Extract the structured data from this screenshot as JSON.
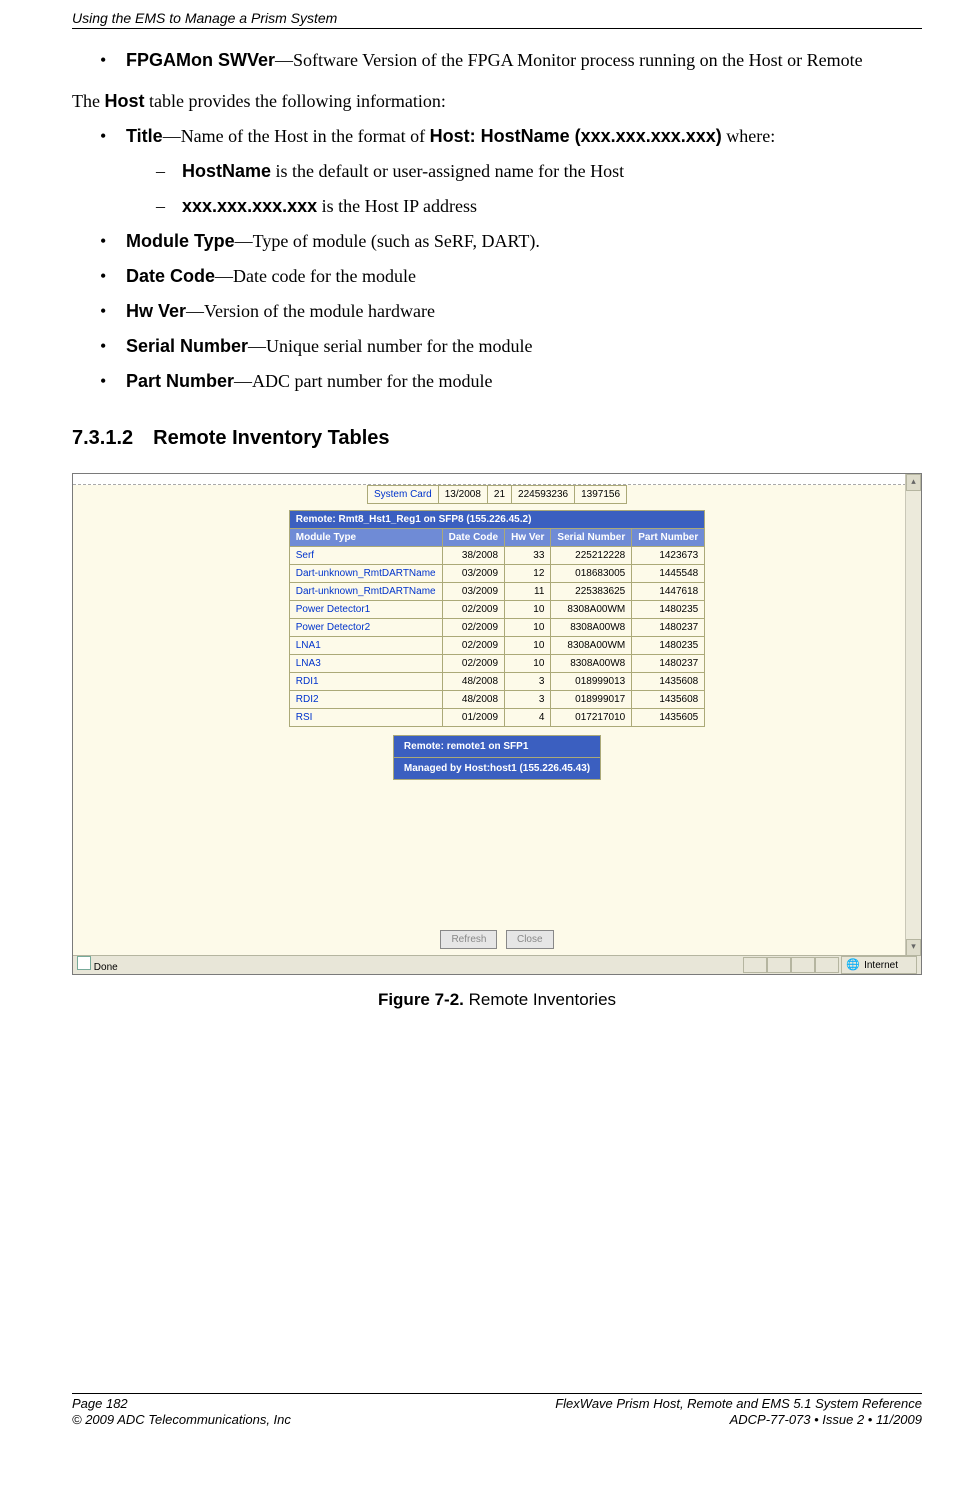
{
  "header": "Using the EMS to Manage a Prism System",
  "bullets_top": {
    "fpga_label": "FPGAMon SWVer",
    "fpga_text": "—Software Version of the FPGA Monitor process running on the Host or Remote"
  },
  "para1_pre": "The ",
  "para1_bold": "Host",
  "para1_post": " table provides the following information:",
  "list": [
    {
      "label": "Title",
      "text": "—Name of the Host in the format of ",
      "bold2": "Host: HostName (xxx.xxx.xxx.xxx)",
      "tail": " where:",
      "sub": [
        {
          "label": "HostName",
          "text": " is the default or user-assigned name for the Host"
        },
        {
          "label": "xxx.xxx.xxx.xxx",
          "text": " is the Host IP address"
        }
      ]
    },
    {
      "label": "Module Type",
      "text": "—Type of module (such as SeRF, DART)."
    },
    {
      "label": "Date Code",
      "text": "—Date code for the module"
    },
    {
      "label": "Hw Ver",
      "text": "—Version of the module hardware"
    },
    {
      "label": "Serial Number",
      "text": "—Unique serial number for the module"
    },
    {
      "label": "Part Number",
      "text": "—ADC part number for the module"
    }
  ],
  "section_num": "7.3.1.2",
  "section_title": "Remote Inventory Tables",
  "shot": {
    "frag_row": {
      "c1": "System Card",
      "c2": "13/2008",
      "c3": "21",
      "c4": "224593236",
      "c5": "1397156"
    },
    "remote_title": "Remote: Rmt8_Hst1_Reg1 on SFP8 (155.226.45.2)",
    "headers": [
      "Module Type",
      "Date Code",
      "Hw Ver",
      "Serial Number",
      "Part Number"
    ],
    "rows": [
      [
        "Serf",
        "38/2008",
        "33",
        "225212228",
        "1423673"
      ],
      [
        "Dart-unknown_RmtDARTName",
        "03/2009",
        "12",
        "018683005",
        "1445548"
      ],
      [
        "Dart-unknown_RmtDARTName",
        "03/2009",
        "11",
        "225383625",
        "1447618"
      ],
      [
        "Power Detector1",
        "02/2009",
        "10",
        "8308A00WM",
        "1480235"
      ],
      [
        "Power Detector2",
        "02/2009",
        "10",
        "8308A00W8",
        "1480237"
      ],
      [
        "LNA1",
        "02/2009",
        "10",
        "8308A00WM",
        "1480235"
      ],
      [
        "LNA3",
        "02/2009",
        "10",
        "8308A00W8",
        "1480237"
      ],
      [
        "RDI1",
        "48/2008",
        "3",
        "018999013",
        "1435608"
      ],
      [
        "RDI2",
        "48/2008",
        "3",
        "018999017",
        "1435608"
      ],
      [
        "RSI",
        "01/2009",
        "4",
        "017217010",
        "1435605"
      ]
    ],
    "box_line1": "Remote: remote1 on SFP1",
    "box_line2": "Managed by Host:host1 (155.226.45.43)",
    "btn_refresh": "Refresh",
    "btn_close": "Close",
    "status_done": "Done",
    "status_internet": "Internet"
  },
  "figure_label": "Figure 7-2.",
  "figure_title": " Remote Inventories",
  "footer": {
    "l1": "Page 182",
    "l2": "© 2009 ADC Telecommunications, Inc",
    "r1": "FlexWave Prism Host, Remote and EMS 5.1 System Reference",
    "r2": "ADCP-77-073  •  Issue 2  •  11/2009"
  }
}
